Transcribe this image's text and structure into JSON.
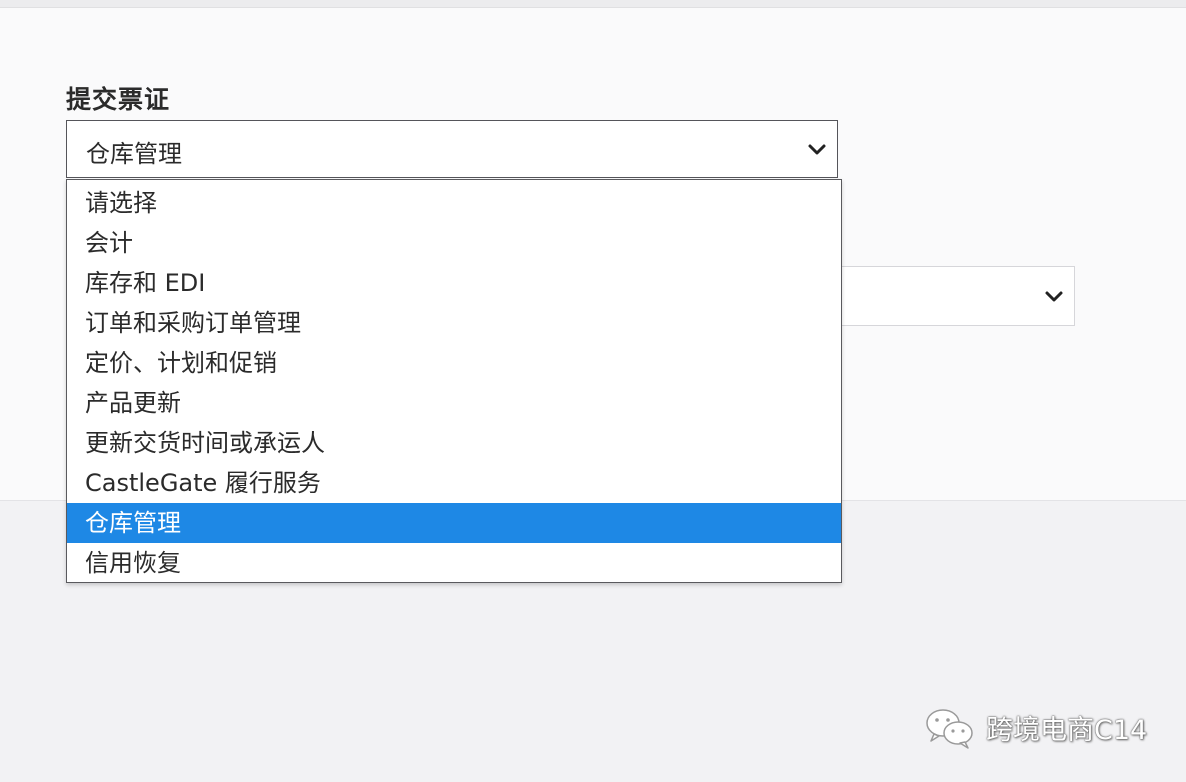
{
  "form": {
    "label": "提交票证",
    "category_select": {
      "value": "仓库管理",
      "options": [
        "请选择",
        "会计",
        "库存和 EDI",
        "订单和采购订单管理",
        "定价、计划和促销",
        "产品更新",
        "更新交货时间或承运人",
        "CastleGate 履行服务",
        "仓库管理",
        "信用恢复"
      ],
      "selected_index": 8
    },
    "secondary_select": {
      "value": ""
    }
  },
  "watermark": {
    "text": "跨境电商C14"
  },
  "colors": {
    "selected_option_bg": "#1e88e5",
    "panel_bg": "#fafafb",
    "page_bg": "#f2f2f4"
  },
  "icons": {
    "select_arrow": "chevron-down-icon",
    "watermark_logo": "wechat-icon"
  }
}
